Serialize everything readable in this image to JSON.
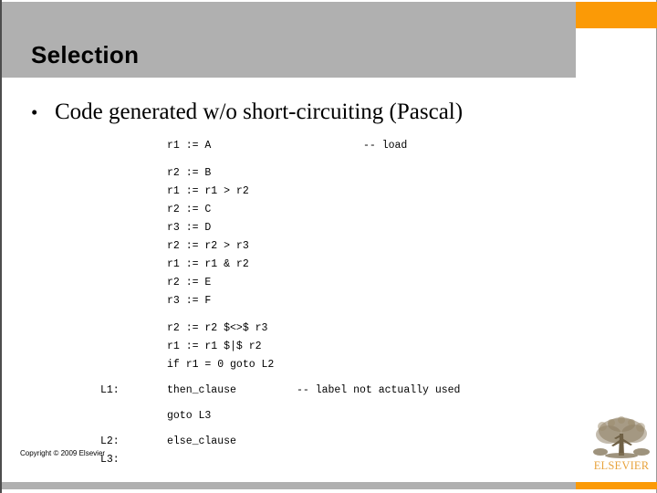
{
  "slide": {
    "title": "Selection",
    "bullet_mark": "•",
    "bullet_text": "Code generated w/o short-circuiting (Pascal)",
    "copyright": "Copyright © 2009 Elsevier",
    "colors": {
      "banner_gray": "#b0b0b0",
      "accent_orange": "#fb9a06",
      "logo_orange": "#e8a33d",
      "text_black": "#000000",
      "background": "#ffffff"
    }
  },
  "code": {
    "lines": [
      {
        "label": "",
        "code": "r1 := A",
        "comment": "-- load",
        "spacing": "gap"
      },
      {
        "label": "",
        "code": "r2 := B",
        "comment": "",
        "spacing": "normal"
      },
      {
        "label": "",
        "code": "r1 := r1 > r2",
        "comment": "",
        "spacing": "normal"
      },
      {
        "label": "",
        "code": "r2 := C",
        "comment": "",
        "spacing": "normal"
      },
      {
        "label": "",
        "code": "r3 := D",
        "comment": "",
        "spacing": "normal"
      },
      {
        "label": "",
        "code": "r2 := r2 > r3",
        "comment": "",
        "spacing": "normal"
      },
      {
        "label": "",
        "code": "r1 := r1 & r2",
        "comment": "",
        "spacing": "normal"
      },
      {
        "label": "",
        "code": "r2 := E",
        "comment": "",
        "spacing": "normal"
      },
      {
        "label": "",
        "code": "r3 := F",
        "comment": "",
        "spacing": "gap"
      },
      {
        "label": "",
        "code": "r2 := r2 $<>$ r3",
        "comment": "",
        "spacing": "normal"
      },
      {
        "label": "",
        "code": "r1 := r1 $|$ r2",
        "comment": "",
        "spacing": "normal"
      },
      {
        "label": "",
        "code": "if r1 = 0 goto L2",
        "comment": "",
        "spacing": "gap2"
      },
      {
        "label": "L1:",
        "code": "then_clause",
        "comment": "-- label not actually used",
        "spacing": "gap2",
        "comment_wide": true
      },
      {
        "label": "",
        "code": "goto L3",
        "comment": "",
        "spacing": "gap2"
      },
      {
        "label": "L2:",
        "code": "else_clause",
        "comment": "",
        "spacing": "normal"
      },
      {
        "label": "L3:",
        "code": "",
        "comment": "",
        "spacing": "normal"
      }
    ]
  },
  "logo": {
    "wordmark": "ELSEVIER",
    "alt": "elsevier-tree-logo"
  }
}
